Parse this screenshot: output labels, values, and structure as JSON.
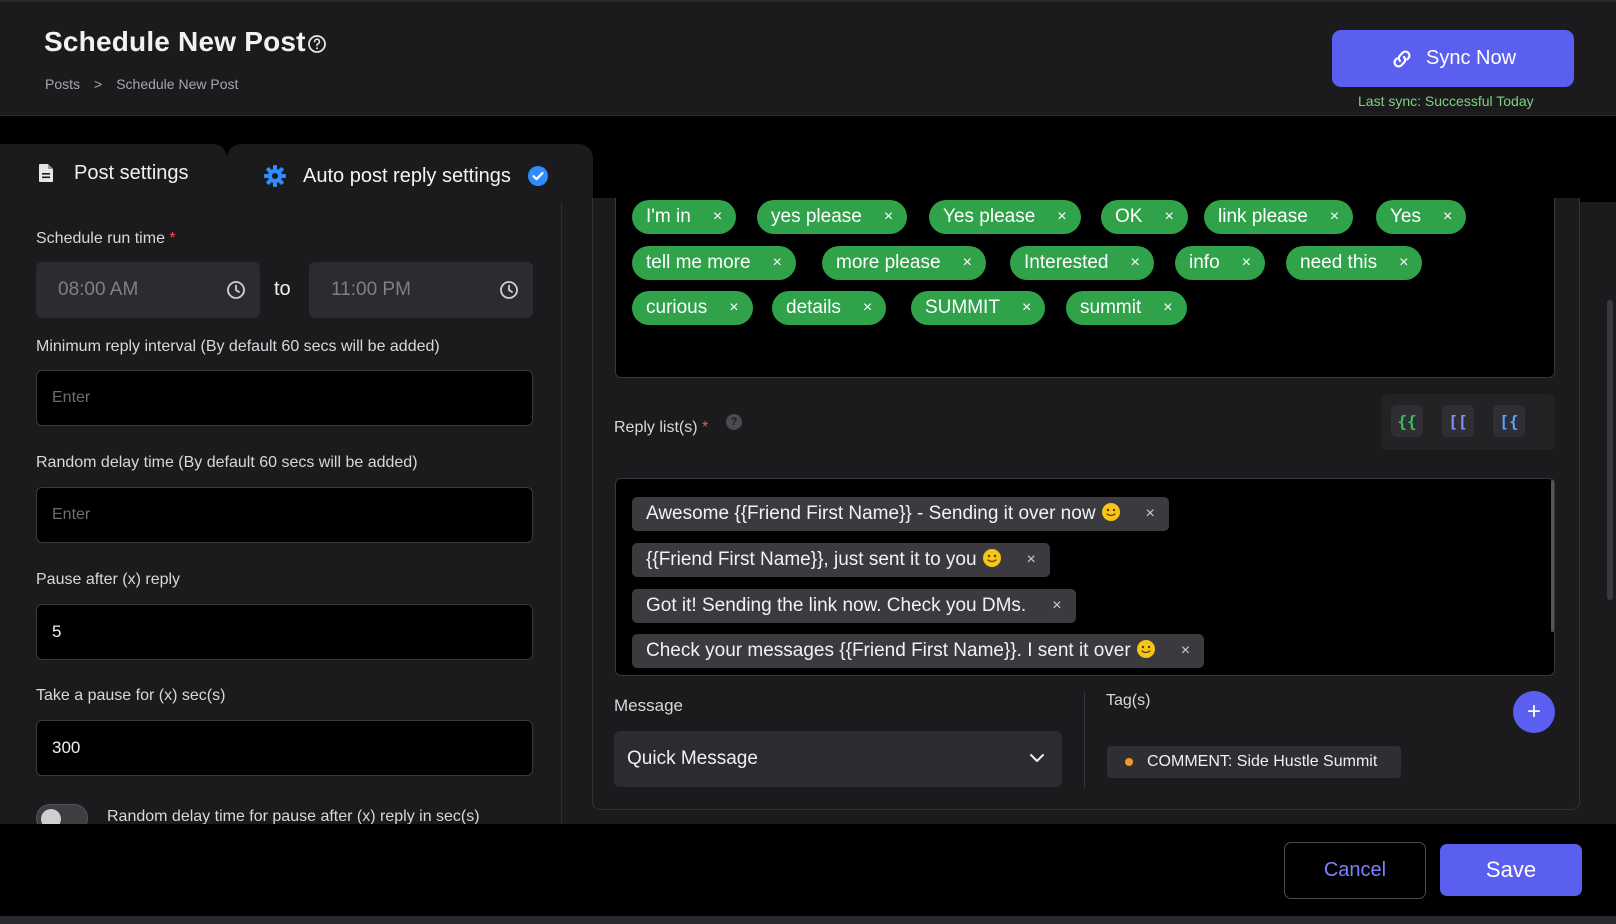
{
  "header": {
    "title": "Schedule New Post",
    "breadcrumb": [
      "Posts",
      ">",
      "Schedule New Post"
    ],
    "sync_label": "Sync Now",
    "last_sync": "Last sync: Successful Today"
  },
  "tabs": [
    {
      "label": "Post settings",
      "icon": "document-icon",
      "active": false
    },
    {
      "label": "Auto post reply settings",
      "icon": "gear-icon",
      "active": true,
      "completed": true
    }
  ],
  "left": {
    "schedule_label": "Schedule run time",
    "required_mark": "*",
    "start_time": "08:00 AM",
    "to_label": "to",
    "end_time": "11:00 PM",
    "min_interval_label": "Minimum reply interval (By default 60 secs will be added)",
    "min_interval_placeholder": "Enter",
    "random_delay_label": "Random delay time (By default 60 secs will be added)",
    "random_delay_placeholder": "Enter",
    "pause_after_label": "Pause after (x) reply",
    "pause_after_value": "5",
    "pause_for_label": "Take a pause for (x) sec(s)",
    "pause_for_value": "300",
    "toggle_label": "Random delay time for pause after (x) reply in sec(s)",
    "toggle_on": false
  },
  "keywords": [
    "I'm in",
    "yes please",
    "Yes please",
    "OK",
    "link please",
    "Yes",
    "tell me more",
    "more please",
    "Interested",
    "info",
    "need this",
    "curious",
    "details",
    "SUMMIT",
    "summit"
  ],
  "chip_close": "×",
  "replies_section": {
    "label": "Reply list(s)",
    "required_mark": "*",
    "help": "?",
    "var_buttons": [
      "{{",
      "[[",
      "[{"
    ]
  },
  "replies": [
    {
      "text": "Awesome {{Friend First Name}} - Sending it over now",
      "emoji": true
    },
    {
      "text": "{{Friend First Name}}, just sent it to you",
      "emoji": true
    },
    {
      "text": "Got it! Sending the link now. Check you DMs.",
      "emoji": false
    },
    {
      "text": "Check your messages {{Friend First Name}}. I sent it over",
      "emoji": true
    }
  ],
  "message": {
    "label": "Message",
    "selected": "Quick Message"
  },
  "tags": {
    "label": "Tag(s)",
    "add": "+",
    "items": [
      "COMMENT: Side Hustle Summit"
    ]
  },
  "footer": {
    "cancel_label": "Cancel",
    "save_label": "Save"
  },
  "colors": {
    "accent": "#5b5ff0",
    "keyword_chip": "#2fa24a",
    "success_text": "#7ed27e",
    "required": "#ff4d4d",
    "tag_dot": "#f19a2a"
  }
}
